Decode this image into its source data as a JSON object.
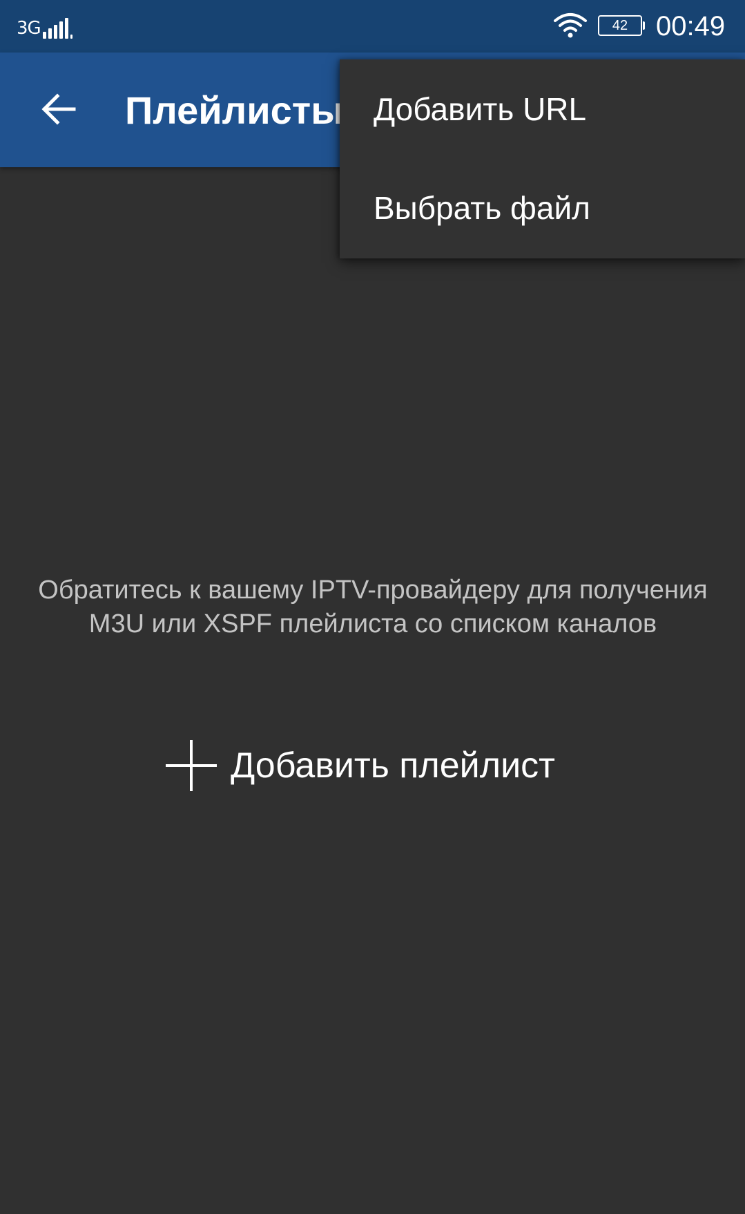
{
  "status_bar": {
    "network": "3G",
    "signal_icon": "signal-bars-icon",
    "wifi_icon": "wifi-icon",
    "battery_level": "42",
    "time": "00:49"
  },
  "toolbar": {
    "back_icon": "arrow-left-icon",
    "title": "Плейлисты",
    "background_color": "#20528f"
  },
  "menu": {
    "items": [
      {
        "label": "Добавить URL"
      },
      {
        "label": "Выбрать файл"
      }
    ]
  },
  "empty_state": {
    "message": "Обратитесь к вашему IPTV-провайдеру для получения M3U или XSPF плейлиста со списком каналов",
    "add_button_icon": "plus-icon",
    "add_button_label": "Добавить плейлист"
  },
  "colors": {
    "status_bar": "#174372",
    "toolbar": "#20528f",
    "background": "#303030",
    "menu": "#323232"
  }
}
